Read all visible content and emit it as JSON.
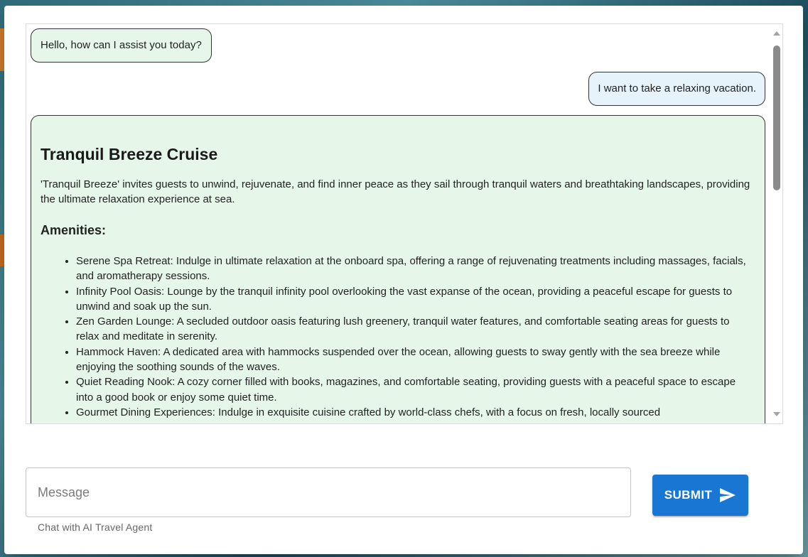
{
  "chat": {
    "messages": [
      {
        "role": "assistant",
        "text": "Hello, how can I assist you today?"
      },
      {
        "role": "user",
        "text": "I want to take a relaxing vacation."
      }
    ],
    "card": {
      "title": "Tranquil Breeze Cruise",
      "description": "'Tranquil Breeze' invites guests to unwind, rejuvenate, and find inner peace as they sail through tranquil waters and breathtaking landscapes, providing the ultimate relaxation experience at sea.",
      "amenities_heading": "Amenities:",
      "amenities": [
        "Serene Spa Retreat: Indulge in ultimate relaxation at the onboard spa, offering a range of rejuvenating treatments including massages, facials, and aromatherapy sessions.",
        "Infinity Pool Oasis: Lounge by the tranquil infinity pool overlooking the vast expanse of the ocean, providing a peaceful escape for guests to unwind and soak up the sun.",
        "Zen Garden Lounge: A secluded outdoor oasis featuring lush greenery, tranquil water features, and comfortable seating areas for guests to relax and meditate in serenity.",
        "Hammock Haven: A dedicated area with hammocks suspended over the ocean, allowing guests to sway gently with the sea breeze while enjoying the soothing sounds of the waves.",
        "Quiet Reading Nook: A cozy corner filled with books, magazines, and comfortable seating, providing guests with a peaceful space to escape into a good book or enjoy some quiet time.",
        "Gourmet Dining Experiences: Indulge in exquisite cuisine crafted by world-class chefs, with a focus on fresh, locally sourced"
      ]
    }
  },
  "input": {
    "placeholder": "Message",
    "value": "",
    "helper_text": "Chat with AI Travel Agent"
  },
  "submit": {
    "label": "SUBMIT",
    "icon": "send-icon"
  },
  "colors": {
    "assistant_bubble": "#e6f7ea",
    "user_bubble": "#e6f3fb",
    "primary": "#1976d2"
  }
}
